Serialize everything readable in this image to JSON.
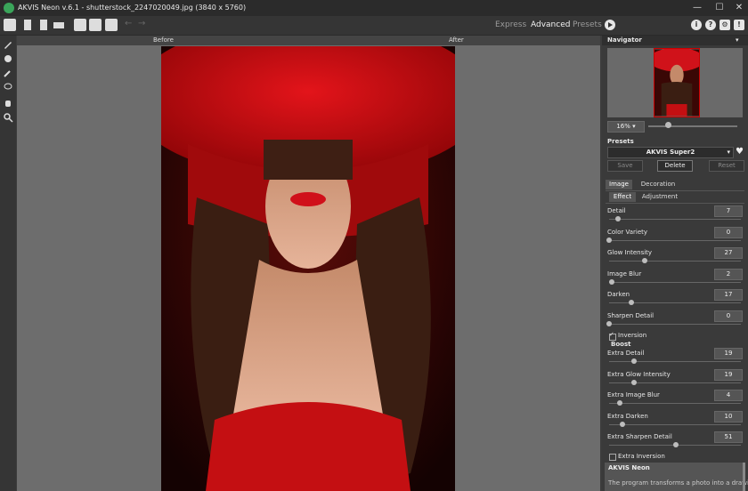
{
  "window": {
    "title": "AKVIS Neon v.6.1 - shutterstock_2247020049.jpg (3840 x 5760)",
    "minimize": "—",
    "maximize": "☐",
    "close": "✕"
  },
  "toolbar": {
    "modes": [
      "Express",
      "Advanced",
      "Presets"
    ],
    "active_mode": "Advanced",
    "right_icons": [
      "info-icon",
      "help-icon",
      "settings-icon",
      "notification-icon"
    ]
  },
  "canvas": {
    "before_label": "Before",
    "after_label": "After"
  },
  "navigator": {
    "title": "Navigator",
    "menu": "▾",
    "zoom": "16% ▾"
  },
  "presets": {
    "title": "Presets",
    "selected": "AKVIS Super2",
    "save": "Save",
    "delete": "Delete",
    "reset": "Reset"
  },
  "tabs": {
    "image": "Image",
    "decoration": "Decoration",
    "effect": "Effect",
    "adjustment": "Adjustment"
  },
  "params": [
    {
      "label": "Detail",
      "value": "7",
      "frac": 0.07
    },
    {
      "label": "Color Variety",
      "value": "0",
      "frac": 0.0
    },
    {
      "label": "Glow Intensity",
      "value": "27",
      "frac": 0.27
    },
    {
      "label": "Image Blur",
      "value": "2",
      "frac": 0.02
    },
    {
      "label": "Darken",
      "value": "17",
      "frac": 0.17
    },
    {
      "label": "Sharpen Detail",
      "value": "0",
      "frac": 0.0
    }
  ],
  "inversion": "Inversion",
  "boost": "Boost",
  "boost_params": [
    {
      "label": "Extra Detail",
      "value": "19",
      "frac": 0.19
    },
    {
      "label": "Extra Glow Intensity",
      "value": "19",
      "frac": 0.19
    },
    {
      "label": "Extra Image Blur",
      "value": "4",
      "frac": 0.08
    },
    {
      "label": "Extra Darken",
      "value": "10",
      "frac": 0.1
    },
    {
      "label": "Extra Sharpen Detail",
      "value": "51",
      "frac": 0.51
    }
  ],
  "extra_inversion": "Extra Inversion",
  "about": {
    "title": "AKVIS Neon",
    "text": "The program transforms a photo into a drawing"
  },
  "colors": {
    "accent_red": "#c8101a"
  }
}
